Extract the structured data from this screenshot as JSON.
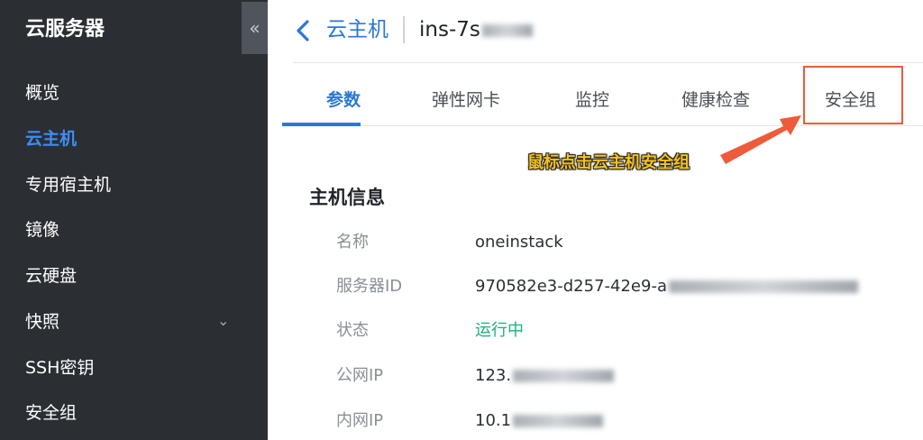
{
  "sidebar": {
    "title": "云服务器",
    "collapse_icon": "double-chevron-left-icon",
    "items": [
      {
        "label": "概览",
        "active": false
      },
      {
        "label": "云主机",
        "active": true
      },
      {
        "label": "专用宿主机",
        "active": false
      },
      {
        "label": "镜像",
        "active": false
      },
      {
        "label": "云硬盘",
        "active": false
      },
      {
        "label": "快照",
        "active": false,
        "expandable": true
      },
      {
        "label": "SSH密钥",
        "active": false
      },
      {
        "label": "安全组",
        "active": false
      }
    ]
  },
  "header": {
    "back_icon": "chevron-left-icon",
    "breadcrumb": "云主机",
    "instance_name": "ins-7s"
  },
  "tabs": [
    {
      "label": "参数",
      "active": true
    },
    {
      "label": "弹性网卡",
      "active": false
    },
    {
      "label": "监控",
      "active": false
    },
    {
      "label": "健康检查",
      "active": false
    },
    {
      "label": "安全组",
      "active": false,
      "highlighted": true
    }
  ],
  "annotation": {
    "text": "鼠标点击云主机安全组",
    "arrow_color": "#ee5a3a",
    "text_color": "#f6c21e"
  },
  "host_info": {
    "title": "主机信息",
    "rows": [
      {
        "label": "名称",
        "value": "oneinstack"
      },
      {
        "label": "服务器ID",
        "value": "970582e3-d257-42e9-a"
      },
      {
        "label": "状态",
        "value": "运行中",
        "status_color": "#19b27a"
      },
      {
        "label": "公网IP",
        "value": "123."
      },
      {
        "label": "内网IP",
        "value": "10.1"
      }
    ]
  },
  "colors": {
    "sidebar_bg": "#2b2e33",
    "accent": "#2a78d6",
    "highlight_border": "#ee5a3a"
  }
}
